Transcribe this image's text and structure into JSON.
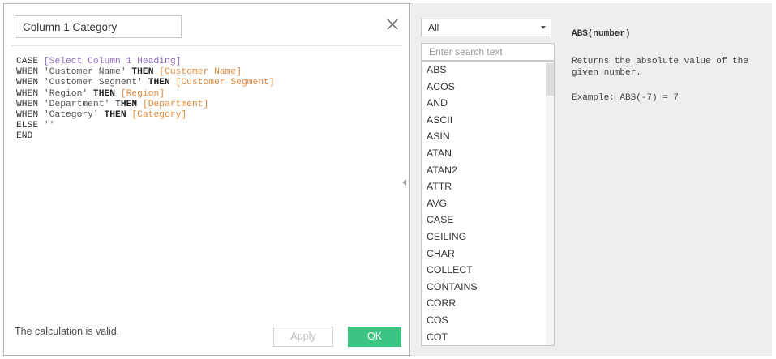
{
  "editor": {
    "calc_name": "Column 1 Category",
    "status": "The calculation is valid.",
    "apply_label": "Apply",
    "ok_label": "OK",
    "code": [
      [
        {
          "t": "CASE ",
          "c": "kw-plain"
        },
        {
          "t": "[Select Column 1 Heading]",
          "c": "param"
        }
      ],
      [
        {
          "t": "WHEN ",
          "c": "kw-plain"
        },
        {
          "t": "'Customer Name' ",
          "c": "str"
        },
        {
          "t": "THEN ",
          "c": "kw"
        },
        {
          "t": "[Customer Name]",
          "c": "field"
        }
      ],
      [
        {
          "t": "WHEN ",
          "c": "kw-plain"
        },
        {
          "t": "'Customer Segment' ",
          "c": "str"
        },
        {
          "t": "THEN ",
          "c": "kw"
        },
        {
          "t": "[Customer Segment]",
          "c": "field"
        }
      ],
      [
        {
          "t": "WHEN ",
          "c": "kw-plain"
        },
        {
          "t": "'Region' ",
          "c": "str"
        },
        {
          "t": "THEN ",
          "c": "kw"
        },
        {
          "t": "[Region]",
          "c": "field"
        }
      ],
      [
        {
          "t": "WHEN ",
          "c": "kw-plain"
        },
        {
          "t": "'Department' ",
          "c": "str"
        },
        {
          "t": "THEN ",
          "c": "kw"
        },
        {
          "t": "[Department]",
          "c": "field"
        }
      ],
      [
        {
          "t": "WHEN ",
          "c": "kw-plain"
        },
        {
          "t": "'Category' ",
          "c": "str"
        },
        {
          "t": "THEN ",
          "c": "kw"
        },
        {
          "t": "[Category]",
          "c": "field"
        }
      ],
      [
        {
          "t": "ELSE ",
          "c": "kw-plain"
        },
        {
          "t": "''",
          "c": "str"
        }
      ],
      [
        {
          "t": "END",
          "c": "kw-plain"
        }
      ]
    ]
  },
  "functions": {
    "category_selected": "All",
    "search_placeholder": "Enter search text",
    "items": [
      "ABS",
      "ACOS",
      "AND",
      "ASCII",
      "ASIN",
      "ATAN",
      "ATAN2",
      "ATTR",
      "AVG",
      "CASE",
      "CEILING",
      "CHAR",
      "COLLECT",
      "CONTAINS",
      "CORR",
      "COS",
      "COT"
    ]
  },
  "help": {
    "signature": "ABS(number)",
    "description": "Returns the absolute value of the given number.",
    "example": "Example: ABS(-7) = 7"
  },
  "icons": {
    "close": "close-icon",
    "dropdown": "chevron-down-icon",
    "collapse": "collapse-left-icon"
  },
  "colors": {
    "ok_button": "#3ec482",
    "parameter": "#8e6cc0",
    "field": "#e38a3a"
  }
}
